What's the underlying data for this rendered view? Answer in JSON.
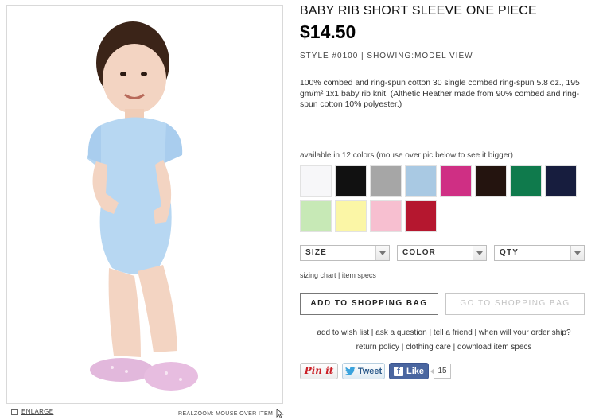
{
  "product": {
    "title": "BABY RIB SHORT SLEEVE ONE PIECE",
    "price": "$14.50",
    "style_line": "STYLE #0100 | SHOWING:MODEL VIEW",
    "description": "100% combed and ring-spun cotton 30 single combed ring-spun 5.8 oz., 195 gm/m² 1x1 baby rib knit. (Althetic Heather made from 90% combed and ring-spun cotton 10% polyester.)"
  },
  "image": {
    "enlarge_label": "ENLARGE",
    "realzoom_label": "REALZOOM: MOUSE OVER ITEM"
  },
  "colors": {
    "available_text": "available in 12 colors (mouse over pic below to see it bigger)",
    "swatches": [
      "#f7f7f9",
      "#111111",
      "#a6a6a6",
      "#a9c9e3",
      "#cf2f84",
      "#24140f",
      "#0f7a4c",
      "#171d3e",
      "#c7e9b6",
      "#fbf6a6",
      "#f7bfd0",
      "#b5172f"
    ]
  },
  "selectors": {
    "size": "SIZE",
    "color": "COLOR",
    "qty": "QTY"
  },
  "size_links": {
    "sizing_chart": "sizing chart",
    "separator": " | ",
    "item_specs": "item specs"
  },
  "buttons": {
    "add_to_bag": "ADD TO SHOPPING BAG",
    "go_to_bag": "GO TO SHOPPING BAG"
  },
  "links_row1": {
    "wish": "add to wish list",
    "question": "ask a question",
    "friend": "tell a friend",
    "ship": "when will your order ship?"
  },
  "links_row2": {
    "return": "return policy",
    "care": "clothing care",
    "download": "download item specs"
  },
  "social": {
    "pin": "Pin it",
    "tweet": "Tweet",
    "like": "Like",
    "like_count": "15"
  }
}
